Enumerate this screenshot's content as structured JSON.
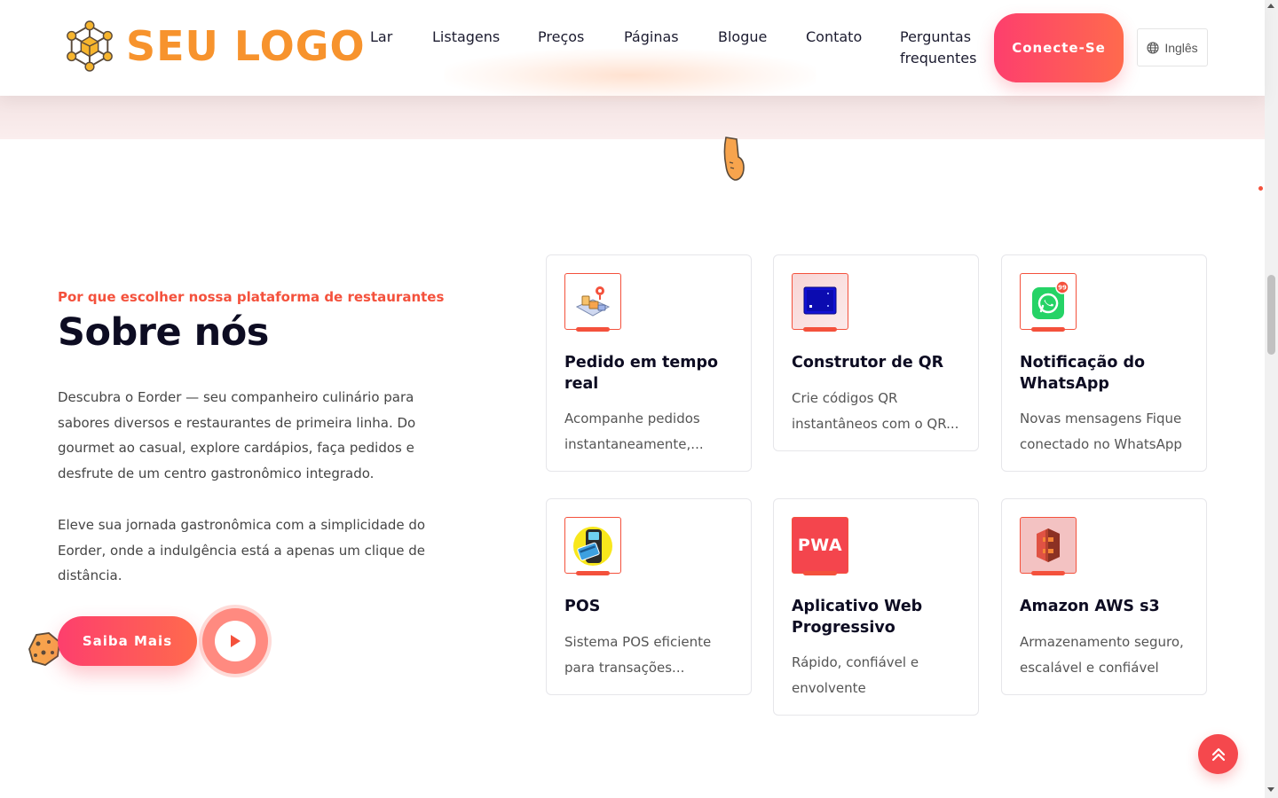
{
  "header": {
    "logo_text": "SEU LOGO",
    "nav": [
      "Lar",
      "Listagens",
      "Preços",
      "Páginas",
      "Blogue",
      "Contato",
      "Perguntas frequentes"
    ],
    "connect_label": "Conecte-Se",
    "language": "Inglês"
  },
  "about": {
    "eyebrow": "Por que escolher nossa plataforma de restaurantes",
    "title": "Sobre nós",
    "para1": "Descubra o Eorder — seu companheiro culinário para sabores diversos e restaurantes de primeira linha. Do gourmet ao casual, explore cardápios, faça pedidos e desfrute de um centro gastronômico integrado.",
    "para2": "Eleve sua jornada gastronômica com a simplicidade do Eorder, onde a indulgência está a apenas um clique de distância.",
    "learn_more_label": "Saiba Mais"
  },
  "features": [
    {
      "title": "Pedido em tempo real",
      "desc": "Acompanhe pedidos instantaneamente,...",
      "icon": "delivery-map-icon"
    },
    {
      "title": "Construtor de QR",
      "desc": "Crie códigos QR instantâneos com o QR...",
      "icon": "qr-builder-icon"
    },
    {
      "title": "Notificação do WhatsApp",
      "desc": "Novas mensagens Fique conectado no WhatsApp",
      "icon": "whatsapp-icon",
      "badge": "99"
    },
    {
      "title": "POS",
      "desc": "Sistema POS eficiente para transações...",
      "icon": "pos-terminal-icon"
    },
    {
      "title": "Aplicativo Web Progressivo",
      "desc": "Rápido, confiável e envolvente",
      "icon": "pwa-icon",
      "icon_text": "PWA"
    },
    {
      "title": "Amazon AWS s3",
      "desc": "Armazenamento seguro, escalável e confiável",
      "icon": "aws-s3-icon"
    }
  ],
  "colors": {
    "accent": "#f4513c",
    "logo": "#f7932d",
    "gradient_start": "#fd3f6d",
    "gradient_end": "#ff6a4d",
    "heading": "#0d0c22"
  }
}
